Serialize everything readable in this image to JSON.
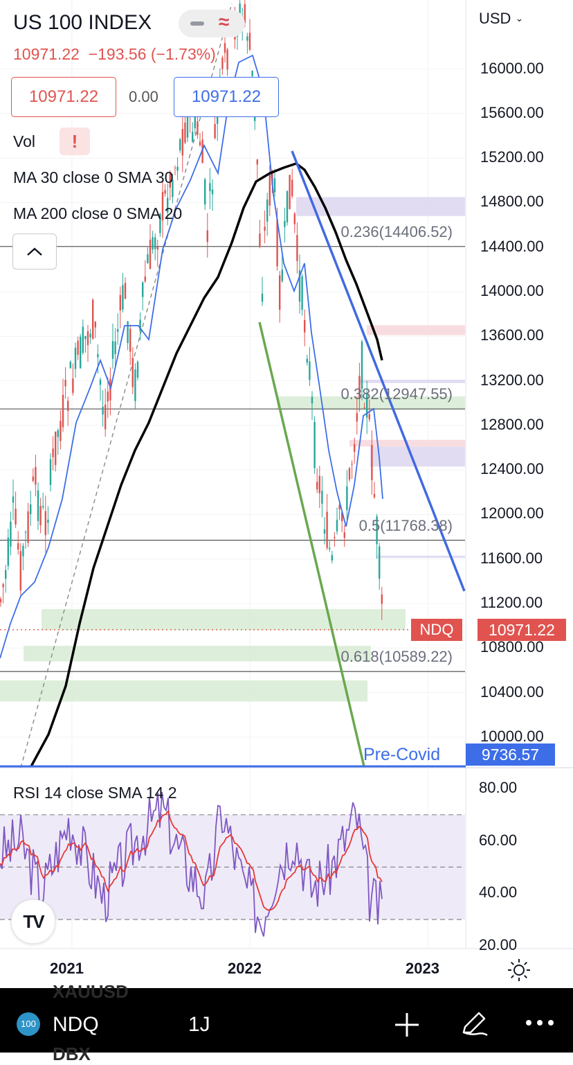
{
  "header": {
    "symbol_title": "US 100 INDEX",
    "price_line": "10971.22  −193.56 (−1.73%)",
    "bid": "10971.22",
    "spread": "0.00",
    "ask": "10971.22",
    "currency": "USD",
    "collapse_icon": "chevron-up-icon",
    "alert_icon": "exclamation-icon",
    "wave_icon": "approx-icon"
  },
  "indicators": {
    "vol": "Vol",
    "ma30": "MA 30 close 0 SMA 30",
    "ma200": "MA 200 close 0 SMA 20",
    "rsi": "RSI 14 close SMA 14 2"
  },
  "price_axis": {
    "ticks": [
      "16000.00",
      "15600.00",
      "15200.00",
      "14800.00",
      "14400.00",
      "14000.00",
      "13600.00",
      "13200.00",
      "12800.00",
      "12400.00",
      "12000.00",
      "11600.00",
      "11200.00",
      "10800.00",
      "10400.00",
      "10000.00"
    ],
    "last_symbol": "NDQ",
    "last_price": "10971.22",
    "pre_covid_label": "Pre-Covid",
    "pre_covid_price": "9736.57"
  },
  "fib_labels": [
    "0.236(14406.52)",
    "0.382(12947.55)",
    "0.5(11768.38)",
    "0.618(10589.22)"
  ],
  "rsi_axis": {
    "ticks": [
      "80.00",
      "60.00",
      "40.00",
      "20.00"
    ]
  },
  "time_axis": {
    "ticks": [
      "2021",
      "2022",
      "2023"
    ],
    "settings_icon": "sun-icon"
  },
  "bottom_bar": {
    "badge": "100",
    "symbol": "NDQ",
    "interval": "1J",
    "add_icon": "plus-icon",
    "draw_icon": "pencil-icon",
    "more_icon": "more-icon",
    "ghost_above": "XAUUSD",
    "ghost_below": "DBX"
  },
  "logo_text": "TV",
  "colors": {
    "down": "#e0534f",
    "up": "#26a69a",
    "ma30": "#3d6ee8",
    "ma200": "#000000",
    "trend_blue": "#4169e1",
    "trend_green": "#6aa84f",
    "rsi": "#7e57c2",
    "rsi_ma": "#e53935",
    "zone_green": "#d7ecd4",
    "zone_purple": "#dcd6f0",
    "zone_pink": "#f7d7da"
  },
  "chart_data": {
    "type": "candlestick",
    "title": "US 100 INDEX",
    "x_ticks": [
      "2021",
      "2022",
      "2023"
    ],
    "y_ticks": [
      10000,
      10400,
      10800,
      11200,
      11600,
      12000,
      12400,
      12800,
      13200,
      13600,
      14000,
      14400,
      14800,
      15200,
      15600,
      16000
    ],
    "last_price": 10971.22,
    "change": -193.56,
    "change_pct": -1.73,
    "fib_levels": [
      {
        "ratio": 0.236,
        "value": 14406.52
      },
      {
        "ratio": 0.382,
        "value": 12947.55
      },
      {
        "ratio": 0.5,
        "value": 11768.38
      },
      {
        "ratio": 0.618,
        "value": 10589.22
      }
    ],
    "pre_covid_level": 9736.57,
    "series": [
      {
        "name": "MA 30 close 0 SMA 30"
      },
      {
        "name": "MA 200 close 0 SMA 20"
      },
      {
        "name": "RSI 14 close SMA 14 2"
      }
    ],
    "rsi_bands": [
      30,
      50,
      70
    ]
  }
}
